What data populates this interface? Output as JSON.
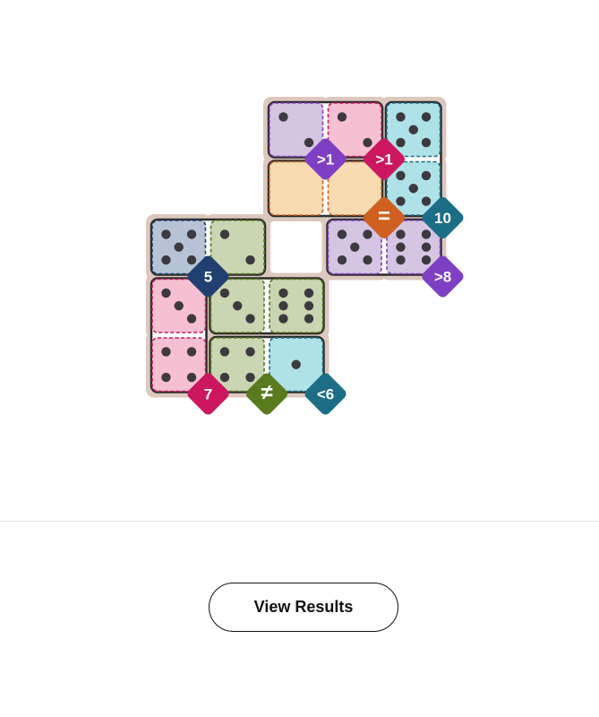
{
  "puzzle": {
    "colors": {
      "background": "#dcc8bd",
      "pip": "#3d3a3f",
      "purple": "#d6c4e3",
      "purple_border": "#7e3fc4",
      "pink": "#f6c0d2",
      "pink_border": "#cc1760",
      "teal": "#aee2e8",
      "teal_border": "#1c6e86",
      "peach": "#f8dbb0",
      "peach_border": "#cf6020",
      "blue": "#b6c3d6",
      "blue_border": "#1f4070",
      "green": "#c9d6b1",
      "green_border": "#5a7a1e",
      "gap_fill": "#ffffff"
    },
    "cells": [
      {
        "id": "r0c2",
        "row": 0,
        "col": 2,
        "color": "purple",
        "pips": 2
      },
      {
        "id": "r0c3",
        "row": 0,
        "col": 3,
        "color": "pink",
        "pips": 2
      },
      {
        "id": "r0c4",
        "row": 0,
        "col": 4,
        "color": "teal",
        "pips": 5
      },
      {
        "id": "r1c2",
        "row": 1,
        "col": 2,
        "color": "peach",
        "pips": 0
      },
      {
        "id": "r1c3",
        "row": 1,
        "col": 3,
        "color": "peach",
        "pips": 0
      },
      {
        "id": "r1c4",
        "row": 1,
        "col": 4,
        "color": "teal",
        "pips": 5
      },
      {
        "id": "r2c0",
        "row": 2,
        "col": 0,
        "color": "blue",
        "pips": 5
      },
      {
        "id": "r2c1",
        "row": 2,
        "col": 1,
        "color": "green",
        "pips": 2
      },
      {
        "id": "r2c3",
        "row": 2,
        "col": 3,
        "color": "purple",
        "pips": 5
      },
      {
        "id": "r2c4",
        "row": 2,
        "col": 4,
        "color": "purple",
        "pips": 6
      },
      {
        "id": "r3c0",
        "row": 3,
        "col": 0,
        "color": "pink",
        "pips": 3
      },
      {
        "id": "r3c1",
        "row": 3,
        "col": 1,
        "color": "green",
        "pips": 3
      },
      {
        "id": "r3c2",
        "row": 3,
        "col": 2,
        "color": "green",
        "pips": 6
      },
      {
        "id": "r4c0",
        "row": 4,
        "col": 0,
        "color": "pink",
        "pips": 4
      },
      {
        "id": "r4c1",
        "row": 4,
        "col": 1,
        "color": "green",
        "pips": 4
      },
      {
        "id": "r4c2",
        "row": 4,
        "col": 2,
        "color": "teal",
        "pips": 1
      }
    ],
    "gaps": [
      {
        "id": "r2c2",
        "row": 2,
        "col": 2
      }
    ],
    "dominoes": [
      [
        "r0c2",
        "r0c3"
      ],
      [
        "r0c4",
        "r1c4"
      ],
      [
        "r1c2",
        "r1c3"
      ],
      [
        "r2c0",
        "r2c1"
      ],
      [
        "r2c3",
        "r2c4"
      ],
      [
        "r3c0",
        "r4c0"
      ],
      [
        "r3c1",
        "r3c2"
      ],
      [
        "r4c1",
        "r4c2"
      ]
    ],
    "badges": [
      {
        "id": "r0c2",
        "label": ">1",
        "color": "purple_border"
      },
      {
        "id": "r0c3",
        "label": ">1",
        "color": "pink_border"
      },
      {
        "id": "r1c3",
        "label": "=",
        "color": "peach_border"
      },
      {
        "id": "r1c4",
        "label": "10",
        "color": "teal_border"
      },
      {
        "id": "r2c0",
        "label": "5",
        "color": "blue_border"
      },
      {
        "id": "r2c4",
        "label": ">8",
        "color": "purple_border"
      },
      {
        "id": "r4c0",
        "label": "7",
        "color": "pink_border"
      },
      {
        "id": "r4c1",
        "label": "≠",
        "color": "green_border"
      },
      {
        "id": "r4c2",
        "label": "<6",
        "color": "teal_border"
      }
    ]
  },
  "actions": {
    "view_results_label": "View Results"
  }
}
